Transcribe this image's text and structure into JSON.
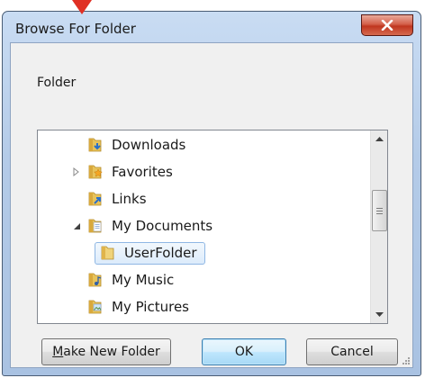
{
  "dialog": {
    "title": "Browse For Folder",
    "instruction": "Folder"
  },
  "tree": {
    "items": [
      {
        "label": "Downloads",
        "icon": "downloads-folder-icon",
        "expander": "none",
        "selected": false
      },
      {
        "label": "Favorites",
        "icon": "favorites-folder-icon",
        "expander": "collapsed",
        "selected": false
      },
      {
        "label": "Links",
        "icon": "links-folder-icon",
        "expander": "none",
        "selected": false
      },
      {
        "label": "My Documents",
        "icon": "documents-folder-icon",
        "expander": "expanded",
        "selected": false
      },
      {
        "label": "UserFolder",
        "icon": "folder-icon",
        "expander": "none",
        "selected": true
      },
      {
        "label": "My Music",
        "icon": "music-folder-icon",
        "expander": "none",
        "selected": false
      },
      {
        "label": "My Pictures",
        "icon": "pictures-folder-icon",
        "expander": "none",
        "selected": false
      }
    ]
  },
  "buttons": {
    "make_new_folder_mnemonic": "M",
    "make_new_folder_rest": "ake New Folder",
    "ok": "OK",
    "cancel": "Cancel"
  },
  "colors": {
    "close_button": "#c0361f",
    "pointer_arrow": "#e03024",
    "selection": "#dcebfb",
    "folder": "#e8c35a"
  }
}
